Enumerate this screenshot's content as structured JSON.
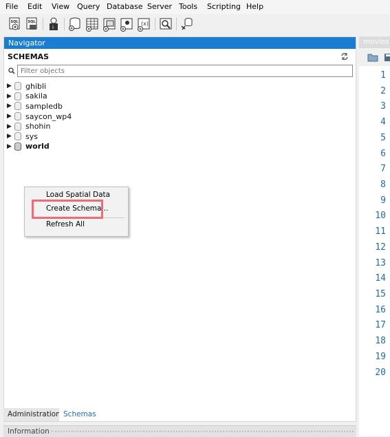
{
  "menubar": {
    "items": [
      "File",
      "Edit",
      "View",
      "Query",
      "Database",
      "Server",
      "Tools",
      "Scripting",
      "Help"
    ]
  },
  "toolbar": {
    "buttons": [
      "new-sql-tab-icon",
      "open-sql-script-icon",
      "inspector-icon",
      "create-schema-icon",
      "create-table-icon",
      "create-view-icon",
      "create-procedure-icon",
      "create-function-icon",
      "search-table-data-icon",
      "reconnect-icon"
    ]
  },
  "navigator": {
    "title": "Navigator",
    "schemas_label": "SCHEMAS",
    "filter_placeholder": "Filter objects",
    "schemas": [
      {
        "name": "ghibli",
        "bold": false
      },
      {
        "name": "sakila",
        "bold": false
      },
      {
        "name": "sampledb",
        "bold": false
      },
      {
        "name": "saycon_wp4",
        "bold": false
      },
      {
        "name": "shohin",
        "bold": false
      },
      {
        "name": "sys",
        "bold": false
      },
      {
        "name": "world",
        "bold": true
      }
    ]
  },
  "context_menu": {
    "items": [
      "Load Spatial Data",
      "Create Schema...",
      "Refresh All"
    ],
    "highlighted": "Create Schema..."
  },
  "tabs": {
    "administration": "Administration",
    "schemas": "Schemas"
  },
  "info_bar": {
    "label": "Information"
  },
  "editor": {
    "tab_title": "movies",
    "line_numbers": [
      "1",
      "2",
      "3",
      "4",
      "5",
      "6",
      "7",
      "8",
      "9",
      "10",
      "11",
      "12",
      "13",
      "14",
      "15",
      "16",
      "17",
      "18",
      "19",
      "20"
    ]
  },
  "colors": {
    "nav_header": "#1a7dd1",
    "highlight": "#f06b78",
    "line_numbers": "#1c6ea4",
    "tab_link": "#1a6fc0"
  }
}
